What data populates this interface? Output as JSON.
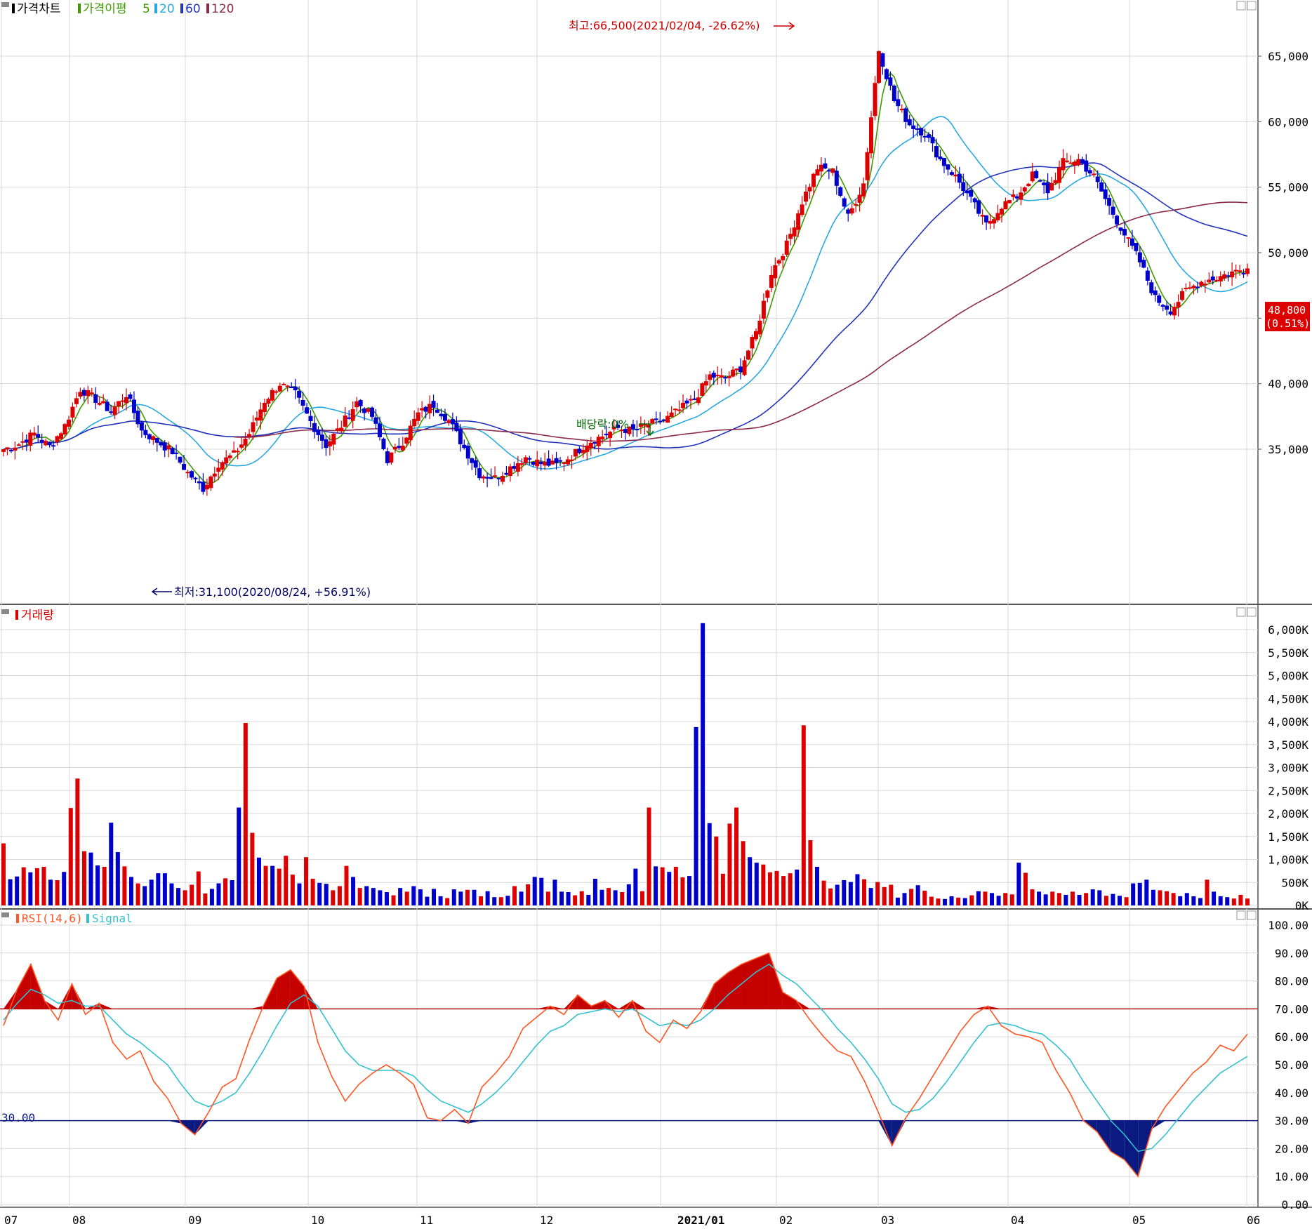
{
  "colors": {
    "up": "#dd0000",
    "down": "#0000cc",
    "ma5": "#3d9a00",
    "ma20": "#2aa8e0",
    "ma60": "#2233bb",
    "ma120": "#8b2a4a",
    "rsi": "#ff5522",
    "signal": "#33c0d0",
    "grid": "#d8d8d8",
    "annot_red": "#cc0000",
    "annot_green": "#006600",
    "price_tag_bg": "#dd0000"
  },
  "price_panel": {
    "title": "가격차트",
    "legend_label": "가격이평",
    "legend_periods": [
      "5",
      "20",
      "60",
      "120"
    ],
    "y_ticks": [
      "65,000",
      "60,000",
      "55,000",
      "50,000",
      "45,000",
      "40,000",
      "35,000"
    ],
    "high_annotation": "최고:66,500(2021/02/04, -26.62%)",
    "low_annotation": "최저:31,100(2020/08/24, +56.91%)",
    "dividend_annotation": "배당락:0%",
    "current_price": "48,800",
    "current_change": "(0.51%)"
  },
  "volume_panel": {
    "title": "거래량",
    "y_ticks": [
      "6,000K",
      "5,500K",
      "5,000K",
      "4,500K",
      "4,000K",
      "3,500K",
      "3,000K",
      "2,500K",
      "2,000K",
      "1,500K",
      "1,000K",
      "500K",
      "0K"
    ]
  },
  "rsi_panel": {
    "title": "RSI(14,6)",
    "signal_label": "Signal",
    "y_ticks": [
      "100.00",
      "90.00",
      "80.00",
      "70.00",
      "60.00",
      "50.00",
      "40.00",
      "30.00",
      "20.00",
      "10.00",
      "0.00"
    ],
    "level_label": "30.00"
  },
  "x_axis": {
    "months": [
      "07",
      "08",
      "09",
      "10",
      "11",
      "12",
      "2021/01",
      "02",
      "03",
      "04",
      "05",
      "06"
    ]
  },
  "chart_data": [
    {
      "type": "candlestick",
      "title": "가격차트",
      "ylim": [
        31100,
        66500
      ],
      "x": [
        "2020-07",
        "2020-08",
        "2020-09",
        "2020-10",
        "2020-11",
        "2020-12",
        "2021-01",
        "2021-02",
        "2021-03",
        "2021-04",
        "2021-05",
        "2021-06"
      ],
      "anchors": [
        {
          "date": "2020-08-24",
          "label": "최저",
          "value": 31100
        },
        {
          "date": "2021-02-04",
          "label": "최고",
          "value": 66500
        }
      ],
      "close_path": [
        35000,
        35400,
        36200,
        35200,
        36800,
        39600,
        38800,
        37900,
        39200,
        36400,
        35600,
        34800,
        33200,
        32000,
        33900,
        34600,
        36200,
        38700,
        40000,
        39200,
        37100,
        35300,
        36800,
        38600,
        37500,
        34200,
        35600,
        37700,
        38400,
        37200,
        35100,
        33100,
        32800,
        33600,
        34400,
        33900,
        33800,
        34500,
        35500,
        36000,
        36600,
        36400,
        36900,
        37200,
        38000,
        38800,
        40600,
        40400,
        41200,
        43900,
        48500,
        50600,
        53900,
        56500,
        56200,
        52700,
        55300,
        65500,
        61600,
        59800,
        59100,
        57100,
        55800,
        54000,
        52100,
        53600,
        54300,
        55900,
        54700,
        56900,
        57100,
        55800,
        53500,
        51400,
        49300,
        46500,
        45600,
        47100,
        47800,
        48100,
        48500,
        48800
      ],
      "last_close": 48800,
      "last_change_pct": 0.51
    },
    {
      "type": "bar",
      "title": "거래량",
      "unit": "K shares",
      "ylim": [
        0,
        6000
      ],
      "values": [
        1350,
        570,
        630,
        830,
        720,
        810,
        840,
        560,
        550,
        730,
        2120,
        2760,
        1180,
        1150,
        870,
        840,
        1800,
        1160,
        850,
        620,
        480,
        420,
        560,
        700,
        700,
        480,
        380,
        330,
        450,
        740,
        260,
        360,
        480,
        590,
        550,
        2130,
        3970,
        1580,
        1040,
        860,
        860,
        800,
        1080,
        670,
        480,
        1050,
        580,
        490,
        470,
        330,
        420,
        860,
        620,
        380,
        420,
        380,
        330,
        290,
        220,
        380,
        300,
        420,
        350,
        190,
        360,
        200,
        160,
        350,
        300,
        340,
        340,
        200,
        310,
        180,
        180,
        210,
        420,
        300,
        460,
        620,
        600,
        300,
        560,
        300,
        290,
        220,
        310,
        230,
        580,
        340,
        380,
        330,
        290,
        460,
        800,
        310,
        2130,
        850,
        830,
        730,
        840,
        610,
        640,
        3880,
        6140,
        1790,
        1500,
        690,
        1780,
        2130,
        1400,
        1050,
        930,
        890,
        720,
        750,
        640,
        700,
        780,
        3920,
        1420,
        840,
        540,
        370,
        450,
        550,
        510,
        680,
        570,
        380,
        510,
        400,
        450,
        170,
        270,
        360,
        440,
        320,
        190,
        150,
        140,
        200,
        170,
        160,
        220,
        310,
        300,
        270,
        210,
        270,
        240,
        930,
        710,
        350,
        300,
        240,
        300,
        270,
        230,
        300,
        230,
        270,
        350,
        330,
        210,
        250,
        210,
        180,
        480,
        490,
        560,
        340,
        330,
        310,
        270,
        200,
        270,
        200,
        160,
        560,
        300,
        200,
        180,
        150,
        230,
        150
      ]
    },
    {
      "type": "line",
      "title": "RSI(14,6)",
      "ylim": [
        0,
        100
      ],
      "reference_lines": [
        70,
        30
      ],
      "series": [
        {
          "name": "RSI(14,6)",
          "values": [
            64,
            77,
            86,
            73,
            66,
            79,
            68,
            72,
            58,
            52,
            55,
            44,
            38,
            29,
            25,
            33,
            42,
            45,
            59,
            71,
            81,
            84,
            78,
            58,
            46,
            37,
            43,
            47,
            50,
            47,
            43,
            31,
            30,
            34,
            29,
            42,
            47,
            53,
            63,
            67,
            71,
            68,
            75,
            71,
            73,
            67,
            73,
            62,
            58,
            66,
            63,
            69,
            79,
            83,
            86,
            88,
            90,
            76,
            73,
            66,
            60,
            55,
            53,
            44,
            33,
            21,
            31,
            38,
            46,
            54,
            62,
            68,
            71,
            64,
            61,
            60,
            58,
            48,
            40,
            30,
            26,
            19,
            16,
            10,
            27,
            35,
            41,
            47,
            51,
            57,
            55,
            61
          ]
        },
        {
          "name": "Signal",
          "values": [
            66,
            72,
            77,
            75,
            72,
            73,
            71,
            71,
            66,
            61,
            58,
            54,
            50,
            43,
            37,
            35,
            37,
            40,
            47,
            55,
            64,
            72,
            75,
            71,
            63,
            55,
            50,
            48,
            48,
            48,
            46,
            41,
            37,
            35,
            33,
            36,
            40,
            45,
            51,
            57,
            62,
            64,
            68,
            69,
            70,
            69,
            70,
            67,
            64,
            65,
            64,
            66,
            70,
            75,
            79,
            83,
            86,
            82,
            79,
            74,
            69,
            63,
            58,
            52,
            45,
            36,
            33,
            34,
            38,
            44,
            51,
            58,
            64,
            65,
            64,
            62,
            61,
            57,
            52,
            44,
            37,
            30,
            25,
            19,
            20,
            25,
            31,
            37,
            42,
            47,
            50,
            53
          ]
        }
      ]
    }
  ]
}
